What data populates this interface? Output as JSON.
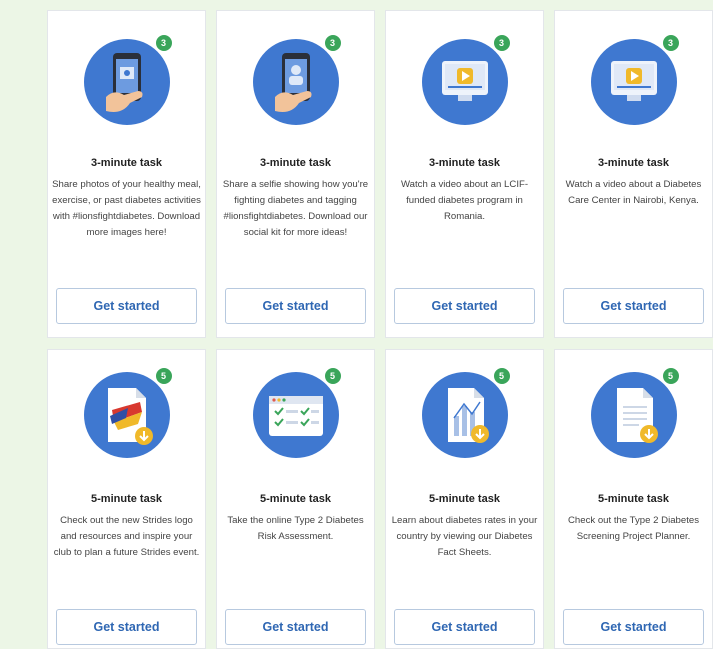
{
  "cards": [
    {
      "badge": "3",
      "title": "3-minute task",
      "desc": "Share photos of your healthy meal, exercise, or past diabetes activities with #lionsfightdiabetes. Download more images here!",
      "button": "Get started",
      "icon": "phone-photo-icon"
    },
    {
      "badge": "3",
      "title": "3-minute task",
      "desc": "Share a selfie showing how you're fighting diabetes and tagging #lionsfightdiabetes. Download our social kit for more ideas!",
      "button": "Get started",
      "icon": "phone-selfie-icon"
    },
    {
      "badge": "3",
      "title": "3-minute task",
      "desc": "Watch a video about an LCIF-funded diabetes program in Romania.",
      "button": "Get started",
      "icon": "video-monitor-icon"
    },
    {
      "badge": "3",
      "title": "3-minute task",
      "desc": "Watch a video about a Diabetes Care Center in Nairobi, Kenya.",
      "button": "Get started",
      "icon": "video-monitor-icon"
    },
    {
      "badge": "5",
      "title": "5-minute task",
      "desc": "Check out the new Strides logo and resources and inspire your club to plan a future Strides event.",
      "button": "Get started",
      "icon": "strides-download-icon"
    },
    {
      "badge": "5",
      "title": "5-minute task",
      "desc": "Take the online Type 2 Diabetes Risk Assessment.",
      "button": "Get started",
      "icon": "checklist-browser-icon"
    },
    {
      "badge": "5",
      "title": "5-minute task",
      "desc": "Learn about diabetes rates in your country by viewing our Diabetes Fact Sheets.",
      "button": "Get started",
      "icon": "chart-download-icon"
    },
    {
      "badge": "5",
      "title": "5-minute task",
      "desc": "Check out the Type 2 Diabetes Screening Project Planner.",
      "button": "Get started",
      "icon": "document-download-icon"
    }
  ]
}
